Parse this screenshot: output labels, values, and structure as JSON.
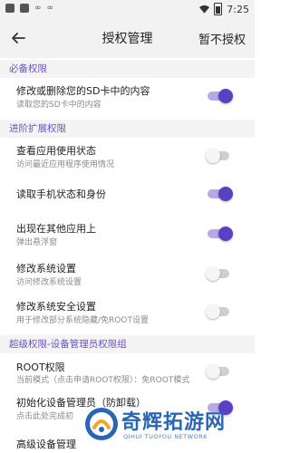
{
  "status_bar": {
    "left_icons": [
      "app-notification-icon",
      "app-notification-icon",
      "infinity-icon",
      "infinity-icon"
    ],
    "time": "7:25"
  },
  "app_bar": {
    "title": "授权管理",
    "action": "暂不授权"
  },
  "sections": [
    {
      "header": "必备权限"
    },
    {
      "header": "进阶扩展权限"
    },
    {
      "header": "超级权限-设备管理员权限组"
    }
  ],
  "permissions": [
    {
      "label": "修改或删除您的SD卡中的内容",
      "sub": "读取您的SD卡中的内容",
      "enabled": true
    },
    {
      "label": "查看应用使用状态",
      "sub": "访问最近应用程序使用情况",
      "enabled": false
    },
    {
      "label": "读取手机状态和身份",
      "sub": "",
      "enabled": true
    },
    {
      "label": "出现在其他应用上",
      "sub": "弹出悬浮窗",
      "enabled": true
    },
    {
      "label": "修改系统设置",
      "sub": "访问修改系统设置",
      "enabled": false
    },
    {
      "label": "修改系统安全设置",
      "sub": "用于修改部分系统隐藏/免ROOT设置",
      "enabled": false
    },
    {
      "label": "ROOT权限",
      "sub": "当前模式（点击申请ROOT权限）：免ROOT模式",
      "enabled": false
    },
    {
      "label": "初始化设备管理员（防卸载）",
      "sub": "点击此处完成初",
      "enabled": true
    },
    {
      "label": "高级设备管理",
      "sub": "",
      "enabled": false
    }
  ],
  "watermark": {
    "title": "奇辉拓游网",
    "subtitle": "QIHUI TUOYOU NETWORK"
  },
  "colors": {
    "accent": "#5b3fc4",
    "section_text": "#6b52c8",
    "watermark": "#2a66b6"
  }
}
